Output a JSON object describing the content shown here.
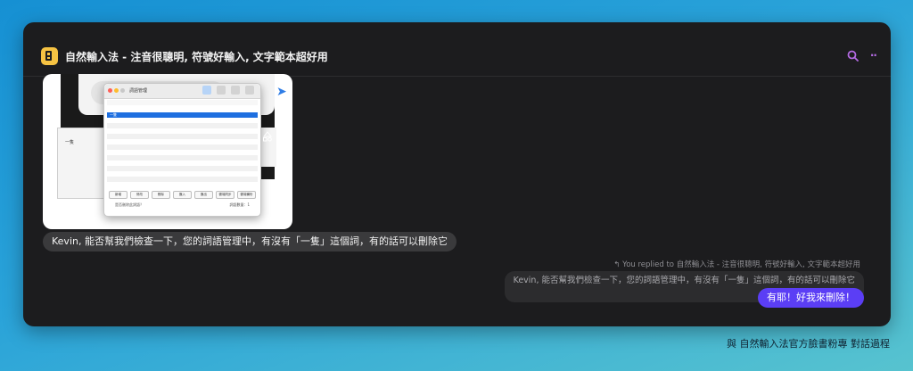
{
  "window": {
    "title": "自然輸入法 - 注音很聰明, 符號好輸入, 文字範本超好用"
  },
  "icons": {
    "app": "app-logo-icon",
    "search": "search-icon",
    "more": "more-icon",
    "reply": "reply-arrow-icon"
  },
  "colors": {
    "accent": "#5b3ef5",
    "search_icon": "#b36ae2",
    "app_icon": "#f6c343"
  },
  "attachment": {
    "dialog_title": "詞語管理",
    "selected_row": "一隻",
    "left_window_text": "一隻",
    "buttons": [
      "新增",
      "修改",
      "刪除",
      "匯入",
      "匯出",
      "雲端同步",
      "雲端備份"
    ],
    "footer_left": "是否刪除此詞語？",
    "footer_right": "詞語數量：1"
  },
  "messages": {
    "incoming": "Kevin, 能否幫我們檢查一下，您的詞語管理中，有沒有「一隻」這個詞，有的話可以刪除它",
    "reply_info": "You replied to 自然輸入法 - 注音很聰明, 符號好輸入, 文字範本超好用",
    "quoted": "Kevin, 能否幫我們檢查一下，您的詞語管理中，有沒有「一隻」這個詞，有的話可以刪除它",
    "outgoing": "有耶！好我來刪除！"
  },
  "caption": "與 自然輸入法官方臉書粉專 對話過程"
}
